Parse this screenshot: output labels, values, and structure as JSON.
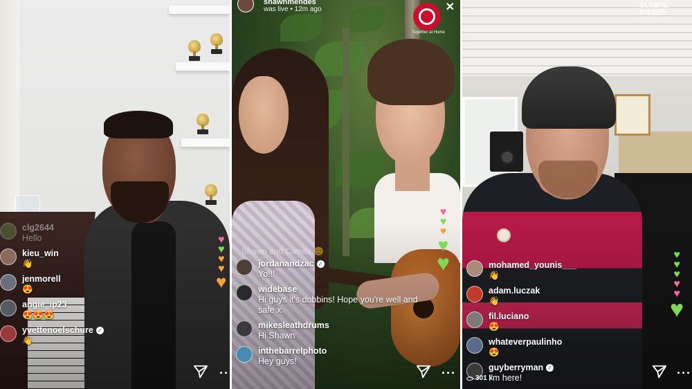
{
  "panels": [
    {
      "id": "john-legend-live",
      "comments": [
        {
          "user": "clg2644",
          "message": "Hello",
          "faded": true,
          "avatar_color": "#5c8a4a"
        },
        {
          "user": "kieu_win",
          "message": "👋",
          "avatar_color": "#8a6a5a"
        },
        {
          "user": "jenmorell",
          "message": "😍",
          "avatar_color": "#6a6f7a"
        },
        {
          "user": "angie_ip23",
          "message": "😍😍😍",
          "avatar_color": "#555a60"
        },
        {
          "user": "yvettenoelschure",
          "message": "👋",
          "verified": true,
          "avatar_color": "#9a3a3a"
        }
      ]
    },
    {
      "id": "shawn-camila-live",
      "header": {
        "username": "shawnmendes",
        "status": "was live • 12m ago"
      },
      "logo_text": "Together at Home",
      "ghost_title": "Shawn and Camila 😊",
      "comments": [
        {
          "user": "jordanandzac",
          "message": "Yo!!!",
          "verified": true,
          "avatar_color": "#4a4038"
        },
        {
          "user": "widebase",
          "message": "Hi guys it's dobbins! Hope you're well and safe x",
          "avatar_color": "#2a2a2a"
        },
        {
          "user": "mikesleathdrums",
          "message": "Hi Shawn",
          "avatar_color": "#3a3a3a"
        },
        {
          "user": "inthebarrelphoto",
          "message": "Hey guys!",
          "avatar_color": "#4a8ab0"
        }
      ]
    },
    {
      "id": "chris-martin-live",
      "watermark": [
        "GLOBAL",
        "CITIZEN"
      ],
      "viewers": "301 k",
      "comments": [
        {
          "user": "mohamed_younis___",
          "message": "👋",
          "avatar_color": "#a88a7a"
        },
        {
          "user": "adam.luczak",
          "message": "👋",
          "avatar_color": "#c0392b"
        },
        {
          "user": "fil.luciano",
          "message": "😍",
          "avatar_color": "#7a7a7a"
        },
        {
          "user": "whateverpaulinho",
          "message": "😍",
          "avatar_color": "#5a6a8a"
        },
        {
          "user": "guyberryman",
          "message": "I'm here!",
          "verified": true,
          "avatar_color": "#3a3a3a"
        }
      ]
    }
  ],
  "colors": {
    "verified_badge": "#3897f0",
    "heart_green": "#7ed957",
    "heart_pink": "#f06aa0",
    "heart_orange": "#f6a23a"
  },
  "icons": {
    "share": "paper-plane-icon",
    "more": "more-dots-icon",
    "verified": "verified-check-icon",
    "close": "close-icon"
  }
}
